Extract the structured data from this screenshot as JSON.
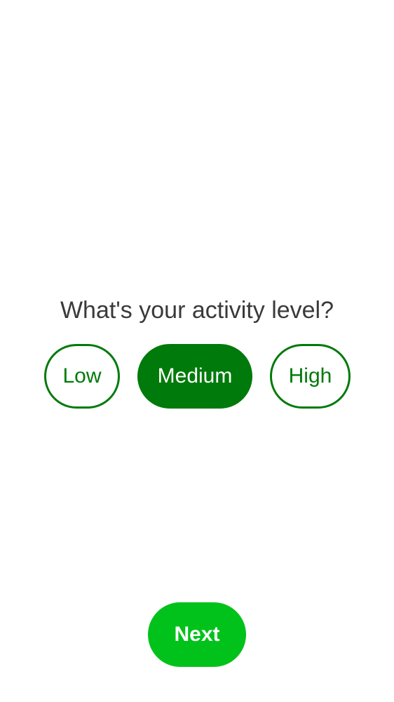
{
  "question": "What's your activity level?",
  "options": [
    {
      "label": "Low",
      "selected": false
    },
    {
      "label": "Medium",
      "selected": true
    },
    {
      "label": "High",
      "selected": false
    }
  ],
  "next_label": "Next",
  "colors": {
    "accent": "#007a0a",
    "next_button": "#00c21a",
    "question_text": "#3a3a3a",
    "background": "#ffffff"
  }
}
